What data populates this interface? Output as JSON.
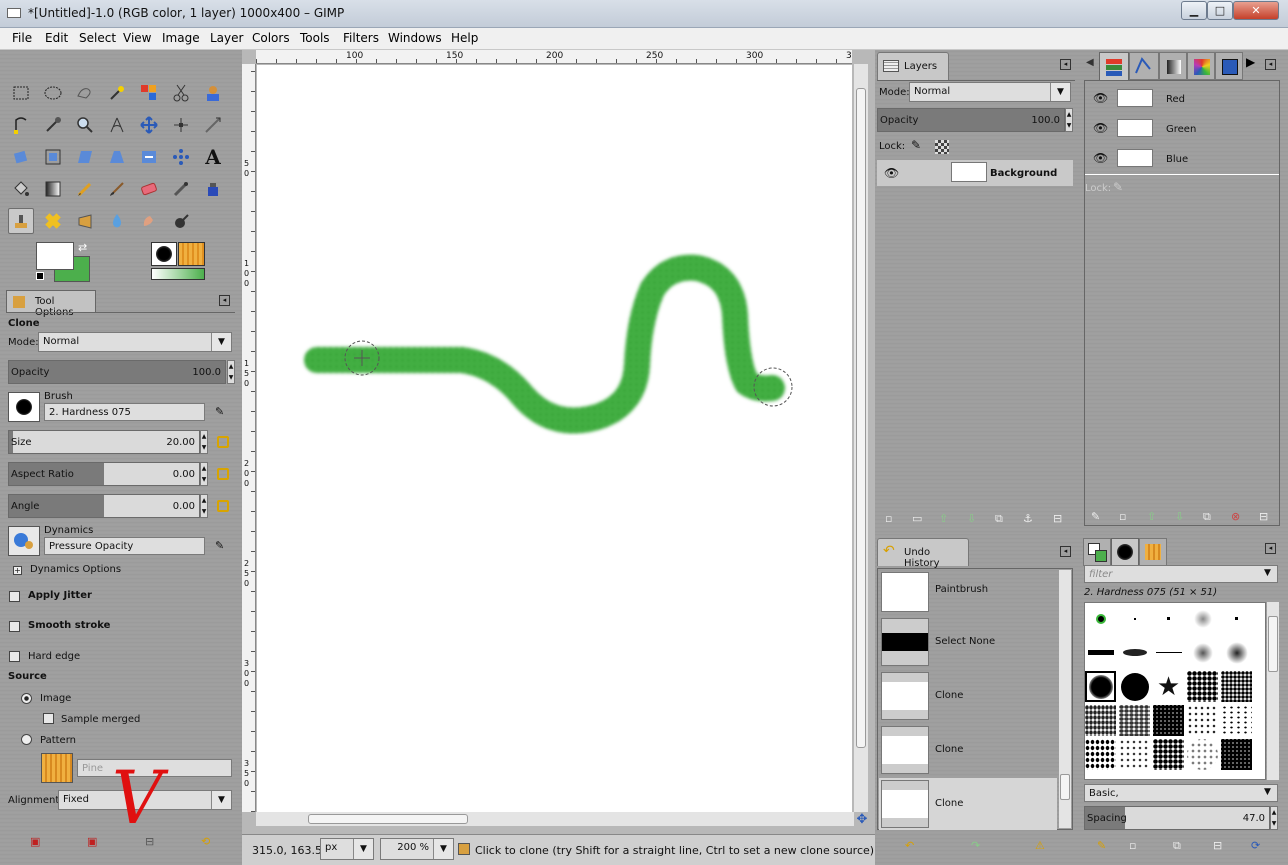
{
  "window": {
    "title": "*[Untitled]-1.0 (RGB color, 1 layer) 1000x400 – GIMP",
    "minimize": "▁",
    "maximize": "□",
    "close": "✕"
  },
  "menu": [
    "File",
    "Edit",
    "Select",
    "View",
    "Image",
    "Layer",
    "Colors",
    "Tools",
    "Filters",
    "Windows",
    "Help"
  ],
  "tool_options": {
    "tab_label": "Tool Options",
    "tool_name": "Clone",
    "mode_label": "Mode:",
    "mode_value": "Normal",
    "opacity_label": "Opacity",
    "opacity_value": "100.0",
    "brush_label": "Brush",
    "brush_value": "2. Hardness 075",
    "size_label": "Size",
    "size_value": "20.00",
    "aspect_label": "Aspect Ratio",
    "aspect_value": "0.00",
    "angle_label": "Angle",
    "angle_value": "0.00",
    "dynamics_label": "Dynamics",
    "dynamics_value": "Pressure Opacity",
    "dynamics_options": "Dynamics Options",
    "apply_jitter": "Apply Jitter",
    "smooth_stroke": "Smooth stroke",
    "hard_edge": "Hard edge",
    "source_label": "Source",
    "source_image": "Image",
    "sample_merged": "Sample merged",
    "source_pattern": "Pattern",
    "pattern_name": "Pine",
    "alignment_label": "Alignment:",
    "alignment_value": "Fixed",
    "annotation": "V"
  },
  "rulers": {
    "h_ticks": [
      "100",
      "150",
      "200",
      "250",
      "300",
      "3"
    ],
    "v_ticks": [
      "5",
      "0",
      "1",
      "0",
      "0",
      "1",
      "5",
      "0",
      "2",
      "0",
      "0",
      "2",
      "5",
      "0",
      "3",
      "0",
      "0",
      "3",
      "5",
      "0"
    ]
  },
  "status": {
    "coords": "315.0, 163.5",
    "unit": "px",
    "zoom": "200 %",
    "message": "Click to clone (try Shift for a straight line, Ctrl to set a new clone source)"
  },
  "layers": {
    "tab_label": "Layers",
    "mode_value": "Normal",
    "opacity_label": "Opacity",
    "opacity_value": "100.0",
    "lock_label": "Lock:",
    "layer_name": "Background"
  },
  "channels": {
    "items": [
      "Red",
      "Green",
      "Blue"
    ],
    "lock_label": "Lock:"
  },
  "undo_history": {
    "tab_label": "Undo History",
    "items": [
      "Paintbrush",
      "Select None",
      "Clone",
      "Clone",
      "Clone"
    ]
  },
  "brushes": {
    "filter_placeholder": "filter",
    "current_brush": "2. Hardness 075 (51 × 51)",
    "preset": "Basic,",
    "spacing_label": "Spacing",
    "spacing_value": "47.0"
  },
  "colors": {
    "fg": "#ffffff",
    "bg": "#4caf4c",
    "stroke": "#3aa83a"
  }
}
